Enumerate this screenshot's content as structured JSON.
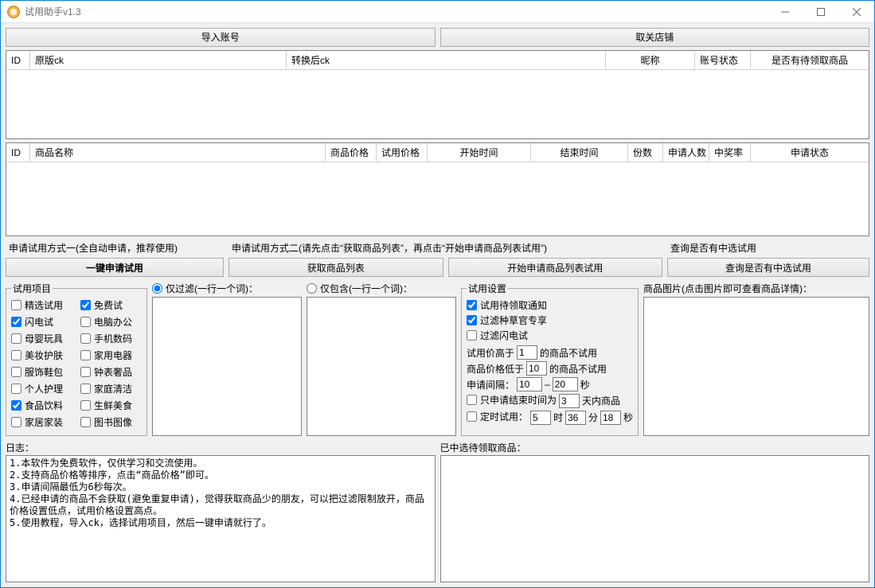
{
  "window": {
    "title": "试用助手v1.3"
  },
  "topButtons": {
    "import": "导入账号",
    "unfollow": "取关店铺"
  },
  "grid1": {
    "headers": {
      "id": "ID",
      "origCk": "原版ck",
      "convCk": "转换后ck",
      "nick": "昵称",
      "acctStatus": "账号状态",
      "hasPending": "是否有待领取商品"
    }
  },
  "grid2": {
    "headers": {
      "id": "ID",
      "name": "商品名称",
      "price": "商品价格",
      "trialPrice": "试用价格",
      "start": "开始时间",
      "end": "结束时间",
      "copies": "份数",
      "applicants": "申请人数",
      "winRate": "中奖率",
      "applyStatus": "申请状态"
    }
  },
  "sections": {
    "method1": {
      "label": "申请试用方式一(全自动申请，推荐使用)",
      "btn": "一键申请试用"
    },
    "method2": {
      "label": "申请试用方式二(请先点击“获取商品列表”，再点击“开始申请商品列表试用”)",
      "btnFetch": "获取商品列表",
      "btnApply": "开始申请商品列表试用"
    },
    "query": {
      "label": "查询是否有中选试用",
      "btn": "查询是否有中选试用"
    }
  },
  "catsLegend": "试用项目",
  "cats": [
    {
      "label": "精选试用",
      "checked": false
    },
    {
      "label": "免费试",
      "checked": true
    },
    {
      "label": "闪电试",
      "checked": true
    },
    {
      "label": "电脑办公",
      "checked": false
    },
    {
      "label": "母婴玩具",
      "checked": false
    },
    {
      "label": "手机数码",
      "checked": false
    },
    {
      "label": "美妆护肤",
      "checked": false
    },
    {
      "label": "家用电器",
      "checked": false
    },
    {
      "label": "服饰鞋包",
      "checked": false
    },
    {
      "label": "钟表奢品",
      "checked": false
    },
    {
      "label": "个人护理",
      "checked": false
    },
    {
      "label": "家庭清洁",
      "checked": false
    },
    {
      "label": "食品饮料",
      "checked": true
    },
    {
      "label": "生鲜美食",
      "checked": false
    },
    {
      "label": "家居家装",
      "checked": false
    },
    {
      "label": "图书图像",
      "checked": false
    }
  ],
  "filters": {
    "onlyExclude": "仅过滤(一行一个词)：",
    "onlyInclude": "仅包含(一行一个词)：",
    "selected": "exclude"
  },
  "settings": {
    "legend": "试用设置",
    "notify": {
      "label": "试用待领取通知",
      "checked": true
    },
    "seedUser": {
      "label": "过滤种草官专享",
      "checked": true
    },
    "flash": {
      "label": "过滤闪电试",
      "checked": false
    },
    "trialPriceAbove": {
      "pre": "试用价高于",
      "val": "1",
      "post": "的商品不试用"
    },
    "goodsPriceBelow": {
      "pre": "商品价格低于",
      "val": "10",
      "post": "的商品不试用"
    },
    "interval": {
      "pre": "申请间隔：",
      "from": "10",
      "to": "20",
      "unit": "秒"
    },
    "endWithin": {
      "label": "只申请结束时间为",
      "val": "3",
      "post": "天内商品",
      "checked": false
    },
    "timed": {
      "label": "定时试用：",
      "h": "5",
      "hUnit": "时",
      "m": "36",
      "mUnit": "分",
      "s": "18",
      "sUnit": "秒",
      "checked": false
    }
  },
  "picLabel": "商品图片(点击图片即可查看商品详情)：",
  "log": {
    "title": "日志：",
    "text": "1.本软件为免费软件，仅供学习和交流使用。\n2.支持商品价格等排序，点击“商品价格”即可。\n3.申请间隔最低为6秒每次。\n4.已经申请的商品不会获取(避免重复申请)，觉得获取商品少的朋友，可以把过滤限制放开，商品价格设置低点，试用价格设置高点。\n5.使用教程，导入ck，选择试用项目，然后一键申请就行了。"
  },
  "winList": {
    "title": "已中选待领取商品："
  }
}
